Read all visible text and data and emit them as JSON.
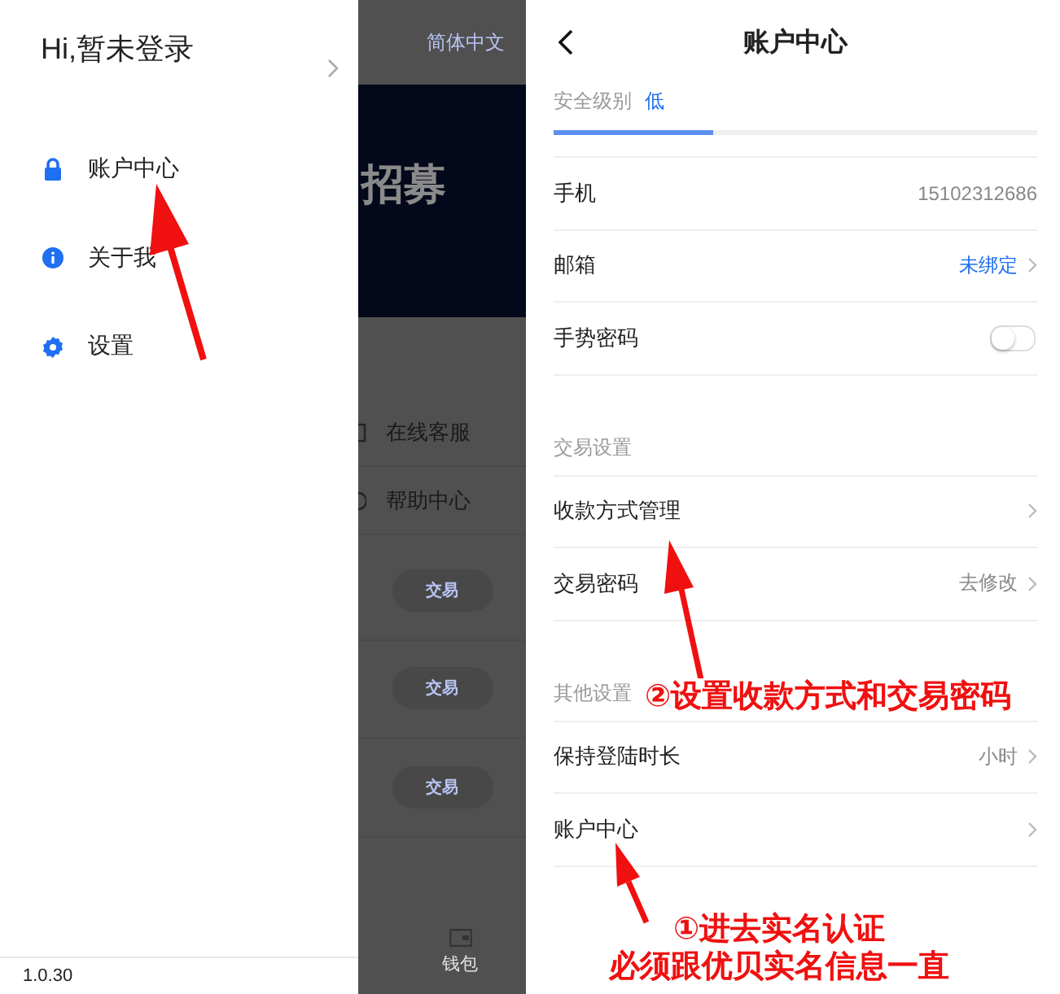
{
  "drawer": {
    "greeting": "Hi,暂未登录",
    "items": [
      {
        "label": "账户中心"
      },
      {
        "label": "关于我"
      },
      {
        "label": "设置"
      }
    ],
    "version": "1.0.30"
  },
  "background_page": {
    "language": "简体中文",
    "banner_text": "招募",
    "services": [
      {
        "label": "在线客服"
      },
      {
        "label": "帮助中心"
      }
    ],
    "trade_buttons": [
      "交易",
      "交易",
      "交易"
    ],
    "nav_label": "钱包"
  },
  "account": {
    "title": "账户中心",
    "security": {
      "label": "安全级别",
      "value": "低",
      "level": 0.33
    },
    "sections": [
      {
        "rows": [
          {
            "kind": "text",
            "label": "手机",
            "value": "15102312686"
          },
          {
            "kind": "link",
            "label": "邮箱",
            "value": "未绑定"
          },
          {
            "kind": "toggle",
            "label": "手势密码",
            "on": false
          }
        ]
      },
      {
        "title": "交易设置",
        "rows": [
          {
            "kind": "nav",
            "label": "收款方式管理"
          },
          {
            "kind": "nav",
            "label": "交易密码",
            "value": "去修改"
          }
        ]
      },
      {
        "title": "其他设置",
        "rows": [
          {
            "kind": "nav",
            "label": "保持登陆时长",
            "value": "小时"
          },
          {
            "kind": "nav",
            "label": "账户中心"
          }
        ]
      }
    ]
  },
  "annotations": [
    {
      "lines": [
        "②设置收款方式和交易密码"
      ]
    },
    {
      "lines": [
        "①进去实名认证",
        "必须跟优贝实名信息一直"
      ]
    }
  ]
}
